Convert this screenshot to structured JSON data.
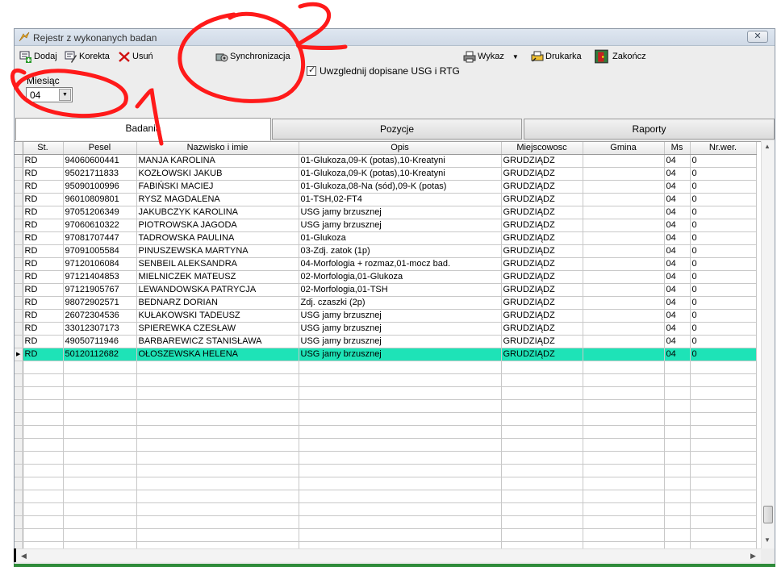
{
  "window": {
    "title": "Rejestr z wykonanych badan",
    "close_label": "✕"
  },
  "toolbar": {
    "add_label": "Dodaj",
    "edit_label": "Korekta",
    "delete_label": "Usuń",
    "sync_label": "Synchronizacja",
    "list_label": "Wykaz",
    "printer_label": "Drukarka",
    "exit_label": "Zakończ"
  },
  "options": {
    "include_usg_label": "Uwzglednij  dopisane USG i RTG",
    "include_usg_checked": true
  },
  "month": {
    "label": "Miesiąc",
    "value": "04"
  },
  "tabs": [
    {
      "label": "Badania",
      "active": true
    },
    {
      "label": "Pozycje",
      "active": false
    },
    {
      "label": "Raporty",
      "active": false
    }
  ],
  "grid": {
    "columns": [
      "St.",
      "Pesel",
      "Nazwisko i imie",
      "Opis",
      "Miejscowosc",
      "Gmina",
      "Ms",
      "Nr.wer."
    ],
    "rows": [
      [
        "RD",
        "94060600441",
        "MANJA KAROLINA",
        "01-Glukoza,09-K (potas),10-Kreatyni",
        "GRUDZIĄDZ",
        "",
        "04",
        "0"
      ],
      [
        "RD",
        "95021711833",
        "KOZŁOWSKI JAKUB",
        "01-Glukoza,09-K (potas),10-Kreatyni",
        "GRUDZIĄDZ",
        "",
        "04",
        "0"
      ],
      [
        "RD",
        "95090100996",
        "FABIŃSKI MACIEJ",
        "01-Glukoza,08-Na (sód),09-K (potas)",
        "GRUDZIĄDZ",
        "",
        "04",
        "0"
      ],
      [
        "RD",
        "96010809801",
        "RYSZ MAGDALENA",
        "01-TSH,02-FT4",
        "GRUDZIĄDZ",
        "",
        "04",
        "0"
      ],
      [
        "RD",
        "97051206349",
        "JAKUBCZYK KAROLINA",
        "USG jamy brzusznej",
        "GRUDZIĄDZ",
        "",
        "04",
        "0"
      ],
      [
        "RD",
        "97060610322",
        "PIOTROWSKA JAGODA",
        "USG jamy brzusznej",
        "GRUDZIĄDZ",
        "",
        "04",
        "0"
      ],
      [
        "RD",
        "97081707447",
        "TADROWSKA PAULINA",
        "01-Glukoza",
        "GRUDZIĄDZ",
        "",
        "04",
        "0"
      ],
      [
        "RD",
        "97091005584",
        "PINUSZEWSKA MARTYNA",
        "03-Zdj. zatok (1p)",
        "GRUDZIĄDZ",
        "",
        "04",
        "0"
      ],
      [
        "RD",
        "97120106084",
        "SENBEIL ALEKSANDRA",
        "04-Morfologia + rozmaz,01-mocz bad.",
        "GRUDZIĄDZ",
        "",
        "04",
        "0"
      ],
      [
        "RD",
        "97121404853",
        "MIELNICZEK MATEUSZ",
        "02-Morfologia,01-Glukoza",
        "GRUDZIĄDZ",
        "",
        "04",
        "0"
      ],
      [
        "RD",
        "97121905767",
        "LEWANDOWSKA PATRYCJA",
        "02-Morfologia,01-TSH",
        "GRUDZIĄDZ",
        "",
        "04",
        "0"
      ],
      [
        "RD",
        "98072902571",
        "BEDNARZ DORIAN",
        "Zdj. czaszki (2p)",
        "GRUDZIĄDZ",
        "",
        "04",
        "0"
      ],
      [
        "RD",
        "26072304536",
        "KUŁAKOWSKI TADEUSZ",
        "USG jamy brzusznej",
        "GRUDZIĄDZ",
        "",
        "04",
        "0"
      ],
      [
        "RD",
        "33012307173",
        "SPIEREWKA CZESŁAW",
        "USG jamy brzusznej",
        "GRUDZIĄDZ",
        "",
        "04",
        "0"
      ],
      [
        "RD",
        "49050711946",
        "BARBAREWICZ STANISŁAWA",
        "USG jamy brzusznej",
        "GRUDZIĄDZ",
        "",
        "04",
        "0"
      ],
      [
        "RD",
        "50120112682",
        "OŁOSZEWSKA HELENA",
        "USG jamy brzusznej",
        "GRUDZIĄDZ",
        "",
        "04",
        "0"
      ]
    ],
    "selected_row": 15,
    "empty_rows": 15
  },
  "colors": {
    "selection": "#1ee3b7",
    "annotation": "#ff1a1a",
    "status_bar": "#2e8b3a"
  }
}
